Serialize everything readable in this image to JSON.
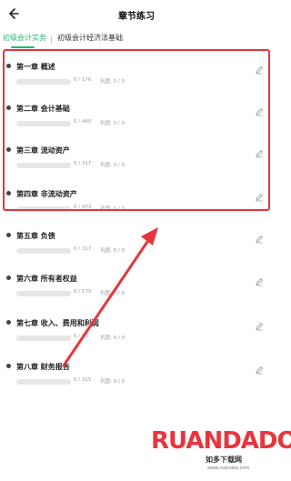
{
  "header": {
    "title": "章节练习"
  },
  "tabs": [
    {
      "label": "初级会计实务",
      "active": true
    },
    {
      "label": "初级会计经济法基础",
      "active": false
    }
  ],
  "chapters": [
    {
      "title": "第一章 概述",
      "progress": "0 / 176",
      "review": "巩固: 0 / 0"
    },
    {
      "title": "第二章 会计基础",
      "progress": "0 / 440",
      "review": "巩固: 0 / 0"
    },
    {
      "title": "第三章 流动资产",
      "progress": "0 / 317",
      "review": "巩固: 0 / 0"
    },
    {
      "title": "第四章 非流动资产",
      "progress": "0 / 473",
      "review": "巩固: 0 / 0"
    },
    {
      "title": "第五章 负债",
      "progress": "0 / 317",
      "review": "巩固: 0 / 0"
    },
    {
      "title": "第六章 所有者权益",
      "progress": "0 / 179",
      "review": "巩固: 0 / 0"
    },
    {
      "title": "第七章 收入、费用和利润",
      "progress": "0 / 35",
      "review": "巩固: 0 / 0"
    },
    {
      "title": "第八章 财务报告",
      "progress": "0 / 315",
      "review": "巩固: 0 / 0"
    }
  ],
  "watermark": {
    "logo_text": "RUANDADO",
    "subtitle": "如多下载网",
    "url": "www.ruandao.com"
  },
  "colors": {
    "accent": "#2bb673",
    "highlight": "#e8353d",
    "muted_text": "#999999"
  },
  "icons": {
    "back": "arrow-left-icon",
    "edit": "pencil-icon",
    "bullet": "dot-icon"
  }
}
